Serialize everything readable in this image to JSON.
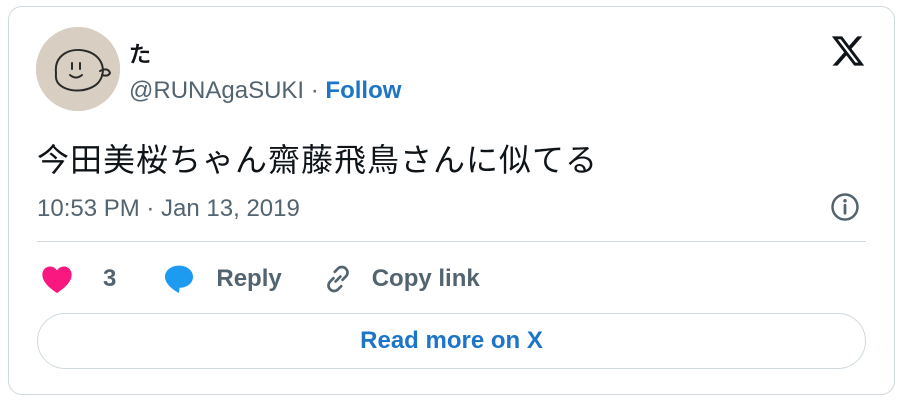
{
  "author": {
    "display_name": "た",
    "handle": "@RUNAgaSUKI",
    "separator": "·",
    "follow_label": "Follow"
  },
  "tweet": {
    "text": "今田美桜ちゃん齋藤飛鳥さんに似てる",
    "timestamp": "10:53 PM · Jan 13, 2019"
  },
  "actions": {
    "like_count": "3",
    "reply_label": "Reply",
    "copy_link_label": "Copy link"
  },
  "footer": {
    "read_more_label": "Read more on X"
  },
  "icons": {
    "logo": "x-logo-icon",
    "info": "info-icon",
    "like": "heart-icon",
    "reply": "speech-bubble-icon",
    "copy": "link-icon"
  },
  "colors": {
    "accent": "#1d74c8",
    "like": "#f91880",
    "reply": "#1d9bf0",
    "muted_text": "#536471",
    "border": "#cfd9de"
  }
}
